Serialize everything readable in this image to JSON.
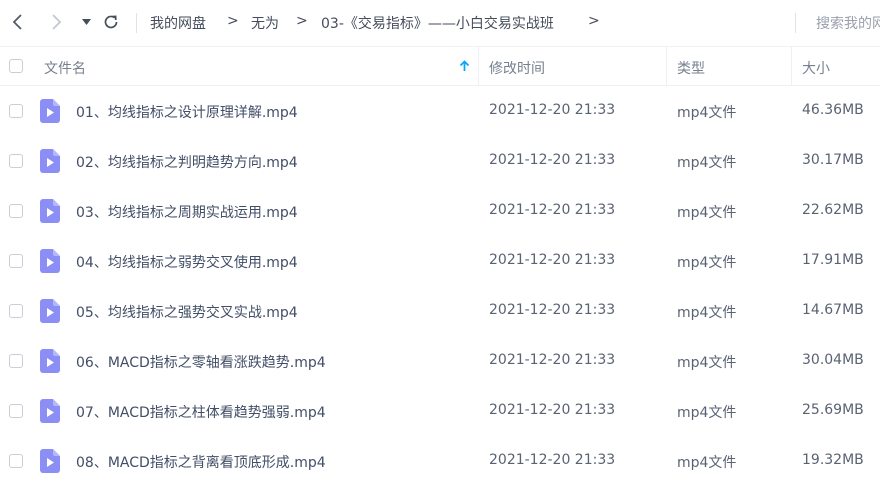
{
  "toolbar": {
    "breadcrumb": [
      "我的网盘",
      "无为",
      "03-《交易指标》——小白交易实战班"
    ],
    "separator": ">",
    "search_placeholder": "搜索我的网"
  },
  "header": {
    "name": "文件名",
    "modified": "修改时间",
    "type": "类型",
    "size": "大小"
  },
  "files": [
    {
      "name": "01、均线指标之设计原理详解.mp4",
      "modified": "2021-12-20 21:33",
      "type": "mp4文件",
      "size": "46.36MB"
    },
    {
      "name": "02、均线指标之判明趋势方向.mp4",
      "modified": "2021-12-20 21:33",
      "type": "mp4文件",
      "size": "30.17MB"
    },
    {
      "name": "03、均线指标之周期实战运用.mp4",
      "modified": "2021-12-20 21:33",
      "type": "mp4文件",
      "size": "22.62MB"
    },
    {
      "name": "04、均线指标之弱势交叉使用.mp4",
      "modified": "2021-12-20 21:33",
      "type": "mp4文件",
      "size": "17.91MB"
    },
    {
      "name": "05、均线指标之强势交叉实战.mp4",
      "modified": "2021-12-20 21:33",
      "type": "mp4文件",
      "size": "14.67MB"
    },
    {
      "name": "06、MACD指标之零轴看涨跌趋势.mp4",
      "modified": "2021-12-20 21:33",
      "type": "mp4文件",
      "size": "30.04MB"
    },
    {
      "name": "07、MACD指标之柱体看趋势强弱.mp4",
      "modified": "2021-12-20 21:33",
      "type": "mp4文件",
      "size": "25.69MB"
    },
    {
      "name": "08、MACD指标之背离看顶底形成.mp4",
      "modified": "2021-12-20 21:33",
      "type": "mp4文件",
      "size": "19.32MB"
    }
  ],
  "colors": {
    "video_icon": "#8b8ff5",
    "sort_arrow": "#06a7ff"
  },
  "icons": {
    "back": "chevron-left-icon",
    "forward": "chevron-right-icon",
    "dropdown": "caret-down-icon",
    "refresh": "refresh-icon",
    "sort": "arrow-up-icon",
    "file": "video-file-icon"
  }
}
